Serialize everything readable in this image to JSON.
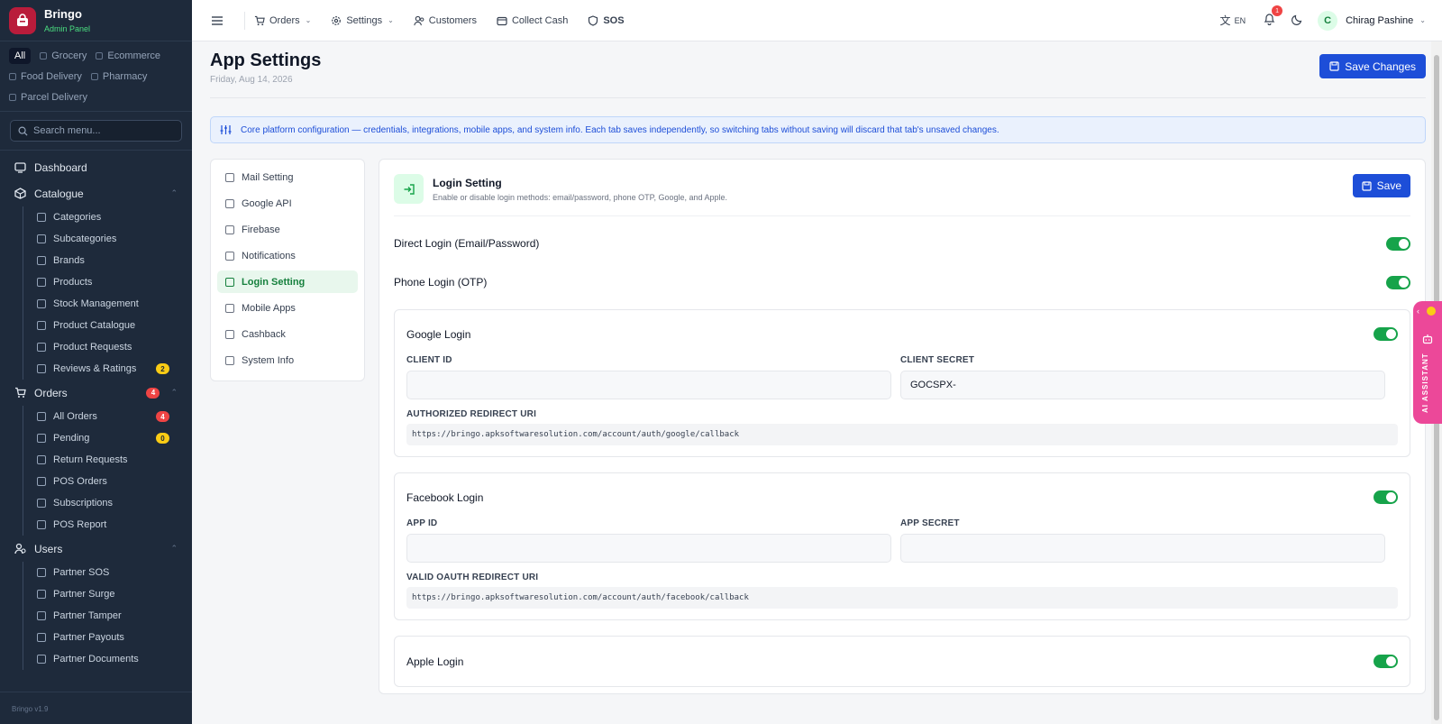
{
  "brand": {
    "name": "Bringo",
    "subtitle": "Admin Panel",
    "version": "Bringo v1.9"
  },
  "filters": [
    "All",
    "Grocery",
    "Ecommerce",
    "Food Delivery",
    "Pharmacy",
    "Parcel Delivery"
  ],
  "search": {
    "placeholder": "Search menu..."
  },
  "nav": {
    "dashboard": "Dashboard",
    "catalogue": {
      "label": "Catalogue",
      "items": [
        "Categories",
        "Subcategories",
        "Brands",
        "Products",
        "Stock Management",
        "Product Catalogue",
        "Product Requests",
        "Reviews & Ratings"
      ],
      "reviews_badge": "2"
    },
    "orders": {
      "label": "Orders",
      "badge": "4",
      "items": [
        "All Orders",
        "Pending",
        "Return Requests",
        "POS Orders",
        "Subscriptions",
        "POS Report"
      ],
      "all_badge": "4",
      "pending_badge": "0"
    },
    "users": {
      "label": "Users",
      "items": [
        "Partner SOS",
        "Partner Surge",
        "Partner Tamper",
        "Partner Payouts",
        "Partner Documents"
      ]
    }
  },
  "topbar": {
    "orders": "Orders",
    "settings": "Settings",
    "customers": "Customers",
    "collect_cash": "Collect Cash",
    "sos": "SOS",
    "lang": "EN",
    "notif_count": "1",
    "user_initial": "C",
    "user_name": "Chirag Pashine"
  },
  "page": {
    "title": "App Settings",
    "date": "Friday, Aug 14, 2026",
    "save_changes": "Save Changes",
    "info": "Core platform configuration — credentials, integrations, mobile apps, and system info. Each tab saves independently, so switching tabs without saving will discard that tab's unsaved changes."
  },
  "tabs": [
    "Mail Setting",
    "Google API",
    "Firebase",
    "Notifications",
    "Login Setting",
    "Mobile Apps",
    "Cashback",
    "System Info"
  ],
  "active_tab": "Login Setting",
  "panel": {
    "title": "Login Setting",
    "subtitle": "Enable or disable login methods: email/password, phone OTP, Google, and Apple.",
    "save": "Save",
    "direct_login": "Direct Login (Email/Password)",
    "phone_login": "Phone Login (OTP)",
    "google": {
      "title": "Google Login",
      "client_id_label": "CLIENT ID",
      "client_id_value": "",
      "client_secret_label": "CLIENT SECRET",
      "client_secret_value": "GOCSPX-",
      "redirect_label": "AUTHORIZED REDIRECT URI",
      "redirect_uri": "https://bringo.apksoftwaresolution.com/account/auth/google/callback"
    },
    "facebook": {
      "title": "Facebook Login",
      "app_id_label": "APP ID",
      "app_id_value": "",
      "app_secret_label": "APP SECRET",
      "app_secret_value": "",
      "redirect_label": "VALID OAUTH REDIRECT URI",
      "redirect_uri": "https://bringo.apksoftwaresolution.com/account/auth/facebook/callback"
    },
    "apple": {
      "title": "Apple Login"
    },
    "toggles": {
      "direct": true,
      "phone": true,
      "google": true,
      "facebook": true,
      "apple": true
    }
  },
  "ai_assistant": "AI ASSISTANT",
  "colors": {
    "primary": "#1d4ed8",
    "success": "#16a34a",
    "sidebar": "#1e2a3b",
    "assistant": "#ec4899"
  }
}
